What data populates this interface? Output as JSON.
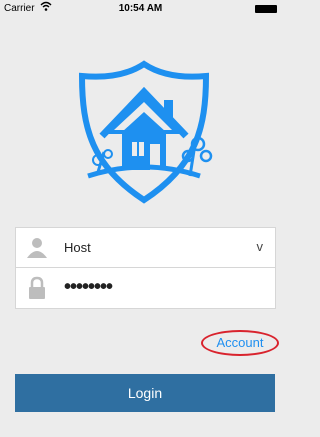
{
  "status_bar": {
    "carrier": "Carrier",
    "time": "10:54 AM"
  },
  "logo": {
    "icon": "shield-house-icon",
    "color": "#1e90f0"
  },
  "form": {
    "username_value": "Host",
    "username_icon": "user-icon",
    "dropdown_icon": "chevron-down-icon",
    "dropdown_glyph": "v",
    "password_value": "••••••••",
    "password_icon": "lock-icon"
  },
  "account_link": "Account",
  "login_label": "Login",
  "colors": {
    "background": "#ececec",
    "accent": "#1f8ff0",
    "button": "#2f6fa1",
    "highlight_circle": "#d9232d"
  }
}
